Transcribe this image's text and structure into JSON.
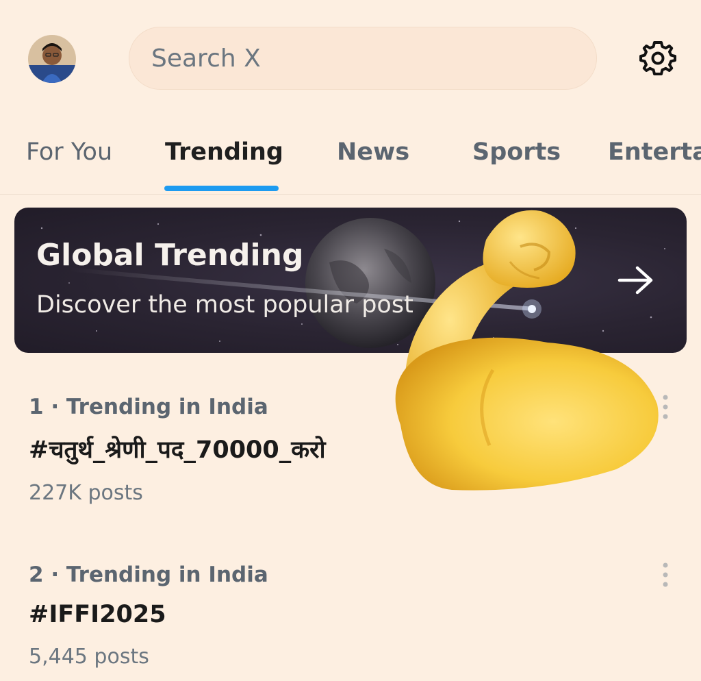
{
  "header": {
    "avatar_alt": "profile avatar",
    "search_placeholder": "Search X"
  },
  "tabs": [
    {
      "label": "For You",
      "active": false
    },
    {
      "label": "Trending",
      "active": true
    },
    {
      "label": "News",
      "active": false
    },
    {
      "label": "Sports",
      "active": false
    },
    {
      "label": "Enterta",
      "active": false
    }
  ],
  "banner": {
    "title": "Global Trending",
    "subtitle": "Discover the most popular post"
  },
  "trends": [
    {
      "meta": "1 · Trending in India",
      "name": "#चतुर्थ_श्रेणी_पद_70000_करो",
      "count": "227K posts"
    },
    {
      "meta": "2 · Trending in India",
      "name": "#IFFI2025",
      "count": "5,445 posts"
    }
  ],
  "overlay": {
    "emoji": "flexed-biceps"
  },
  "colors": {
    "background": "#fdefe1",
    "accent": "#1d9bf0",
    "banner_bg": "#2a2432"
  }
}
